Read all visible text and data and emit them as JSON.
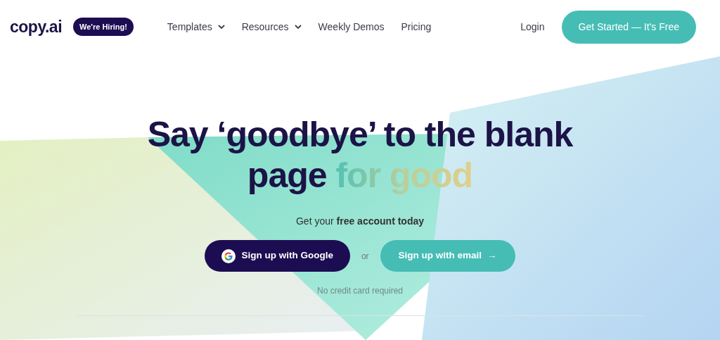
{
  "logo": "copy.ai",
  "hiring_badge": "We're Hiring!",
  "nav": [
    {
      "label": "Templates",
      "dropdown": true
    },
    {
      "label": "Resources",
      "dropdown": true
    },
    {
      "label": "Weekly Demos",
      "dropdown": false
    },
    {
      "label": "Pricing",
      "dropdown": false
    }
  ],
  "login": "Login",
  "cta": "Get Started — It's Free",
  "headline": {
    "text": "Say ‘goodbye’ to the blank page",
    "highlight": "for good"
  },
  "subtitle": "Get your **free account today**",
  "signup_buttons": [
    {
      "kind": "google",
      "label": "Sign up with Google"
    },
    {
      "kind": "email",
      "label": "Sign up with email",
      "arrow": "→"
    }
  ],
  "separator": "or",
  "note": "No credit card required"
}
